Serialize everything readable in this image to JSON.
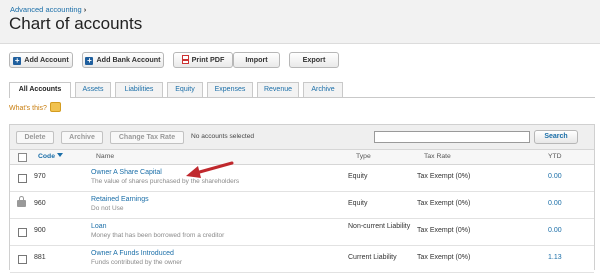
{
  "header": {
    "breadcrumb": "Advanced accounting",
    "breadcrumb_sep": "›",
    "title": "Chart of accounts"
  },
  "toolbar": {
    "add_account": "Add Account",
    "add_bank_account": "Add Bank Account",
    "print_pdf": "Print PDF",
    "import": "Import",
    "export": "Export"
  },
  "tabs": [
    "All Accounts",
    "Assets",
    "Liabilities",
    "Equity",
    "Expenses",
    "Revenue",
    "Archive"
  ],
  "active_tab": "All Accounts",
  "whats_this": "What's this?",
  "actions": {
    "delete": "Delete",
    "archive": "Archive",
    "change_tax_rate": "Change Tax Rate",
    "selection_status": "No accounts selected",
    "search_value": "",
    "search_button": "Search"
  },
  "table": {
    "headers": {
      "code": "Code",
      "name": "Name",
      "type": "Type",
      "tax_rate": "Tax Rate",
      "ytd": "YTD"
    },
    "rows": [
      {
        "code": "970",
        "name": "Owner A Share Capital",
        "description": "The value of shares purchased by the shareholders",
        "type": "Equity",
        "tax_rate": "Tax Exempt (0%)",
        "ytd": "0.00",
        "locked": false
      },
      {
        "code": "960",
        "name": "Retained Earnings",
        "description": "Do not Use",
        "type": "Equity",
        "tax_rate": "Tax Exempt (0%)",
        "ytd": "0.00",
        "locked": true
      },
      {
        "code": "900",
        "name": "Loan",
        "description": "Money that has been borrowed from a creditor",
        "type": "Non-current Liability",
        "tax_rate": "Tax Exempt (0%)",
        "ytd": "0.00",
        "locked": false
      },
      {
        "code": "881",
        "name": "Owner A Funds Introduced",
        "description": "Funds contributed by the owner",
        "type": "Current Liability",
        "tax_rate": "Tax Exempt (0%)",
        "ytd": "1.13",
        "locked": false
      }
    ]
  },
  "colors": {
    "link": "#1a6ea8",
    "annotation_arrow": "#c0282d"
  }
}
